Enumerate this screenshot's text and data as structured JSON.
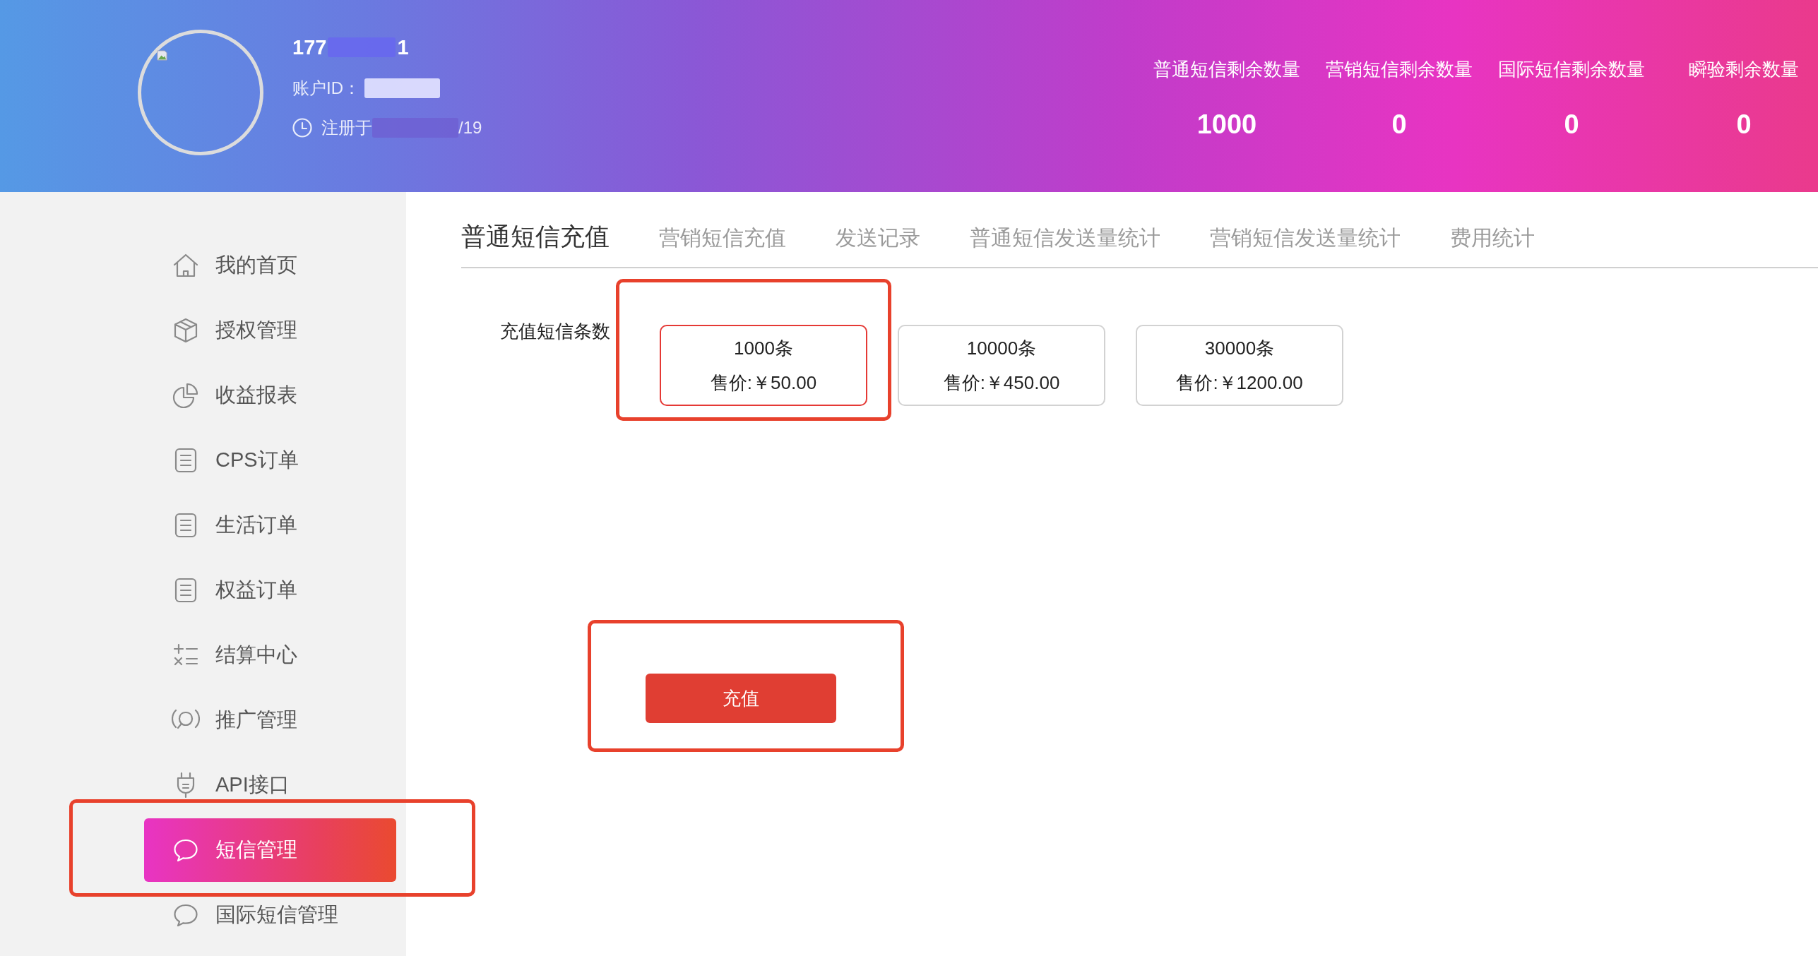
{
  "profile": {
    "phone_start": "177",
    "phone_end": "1",
    "account_label": "账户ID：",
    "registered_start": "注册于",
    "registered_end": "/19"
  },
  "stats": [
    {
      "label": "普通短信剩余数量",
      "value": "1000"
    },
    {
      "label": "营销短信剩余数量",
      "value": "0"
    },
    {
      "label": "国际短信剩余数量",
      "value": "0"
    },
    {
      "label": "瞬验剩余数量",
      "value": "0"
    }
  ],
  "sidebar": {
    "items": [
      {
        "label": "我的首页",
        "selected": false,
        "highlighted": false
      },
      {
        "label": "授权管理",
        "selected": false,
        "highlighted": false
      },
      {
        "label": "收益报表",
        "selected": false,
        "highlighted": false
      },
      {
        "label": "CPS订单",
        "selected": false,
        "highlighted": false
      },
      {
        "label": "生活订单",
        "selected": false,
        "highlighted": false
      },
      {
        "label": "权益订单",
        "selected": false,
        "highlighted": false
      },
      {
        "label": "结算中心",
        "selected": false,
        "highlighted": false
      },
      {
        "label": "推广管理",
        "selected": false,
        "highlighted": false
      },
      {
        "label": "API接口",
        "selected": false,
        "highlighted": false
      },
      {
        "label": "短信管理",
        "selected": true,
        "highlighted": true
      },
      {
        "label": "国际短信管理",
        "selected": false,
        "highlighted": false
      }
    ]
  },
  "tabs": [
    {
      "label": "普通短信充值",
      "selected": true
    },
    {
      "label": "营销短信充值",
      "selected": false
    },
    {
      "label": "发送记录",
      "selected": false
    },
    {
      "label": "普通短信发送量统计",
      "selected": false
    },
    {
      "label": "营销短信发送量统计",
      "selected": false
    },
    {
      "label": "费用统计",
      "selected": false
    }
  ],
  "recharge": {
    "label": "充值短信条数",
    "options": [
      {
        "quantity": "1000条",
        "price": "售价:￥50.00",
        "selected": true,
        "highlighted": true
      },
      {
        "quantity": "10000条",
        "price": "售价:￥450.00",
        "selected": false,
        "highlighted": false
      },
      {
        "quantity": "30000条",
        "price": "售价:￥1200.00",
        "selected": false,
        "highlighted": false
      }
    ],
    "submit": {
      "label": "充值",
      "highlighted": true
    }
  }
}
